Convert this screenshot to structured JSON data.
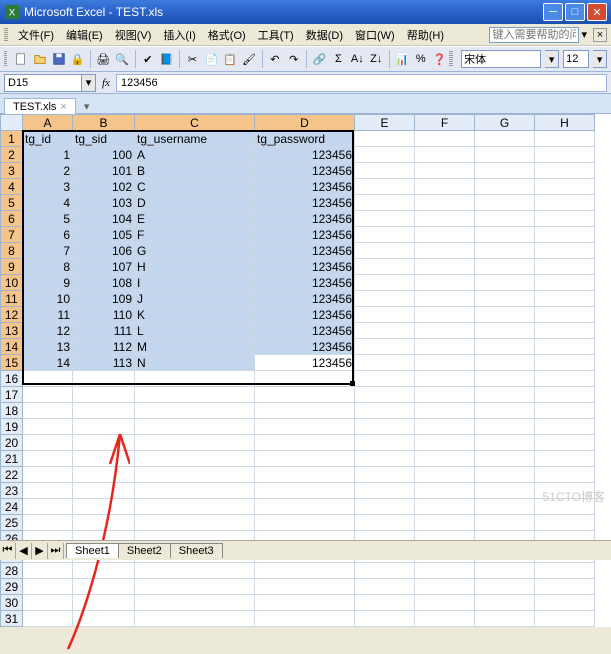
{
  "title": "Microsoft Excel - TEST.xls",
  "menu": {
    "file": "文件(F)",
    "edit": "编辑(E)",
    "view": "视图(V)",
    "insert": "插入(I)",
    "format": "格式(O)",
    "tools": "工具(T)",
    "data": "数据(D)",
    "window": "窗口(W)",
    "help": "帮助(H)",
    "help_ph": "键入需要帮助的问题"
  },
  "toolbar": {
    "font_name": "宋体",
    "font_size": "12"
  },
  "namebox": {
    "ref": "D15",
    "formula": "123456"
  },
  "wktab": {
    "name": "TEST.xls"
  },
  "columns": {
    "A": "A",
    "B": "B",
    "C": "C",
    "D": "D",
    "E": "E",
    "F": "F",
    "G": "G",
    "H": "H"
  },
  "headers": {
    "c0": "tg_id",
    "c1": "tg_sid",
    "c2": "tg_username",
    "c3": "tg_password"
  },
  "rows": [
    {
      "id": "1",
      "sid": "100",
      "u": "A",
      "p": "123456"
    },
    {
      "id": "2",
      "sid": "101",
      "u": "B",
      "p": "123456"
    },
    {
      "id": "3",
      "sid": "102",
      "u": "C",
      "p": "123456"
    },
    {
      "id": "4",
      "sid": "103",
      "u": "D",
      "p": "123456"
    },
    {
      "id": "5",
      "sid": "104",
      "u": "E",
      "p": "123456"
    },
    {
      "id": "6",
      "sid": "105",
      "u": "F",
      "p": "123456"
    },
    {
      "id": "7",
      "sid": "106",
      "u": "G",
      "p": "123456"
    },
    {
      "id": "8",
      "sid": "107",
      "u": "H",
      "p": "123456"
    },
    {
      "id": "9",
      "sid": "108",
      "u": "I",
      "p": "123456"
    },
    {
      "id": "10",
      "sid": "109",
      "u": "J",
      "p": "123456"
    },
    {
      "id": "11",
      "sid": "110",
      "u": "K",
      "p": "123456"
    },
    {
      "id": "12",
      "sid": "111",
      "u": "L",
      "p": "123456"
    },
    {
      "id": "13",
      "sid": "112",
      "u": "M",
      "p": "123456"
    },
    {
      "id": "14",
      "sid": "113",
      "u": "N",
      "p": "123456"
    }
  ],
  "sheets": {
    "s1": "Sheet1",
    "s2": "Sheet2",
    "s3": "Sheet3"
  },
  "watermark": "51CTO博客"
}
